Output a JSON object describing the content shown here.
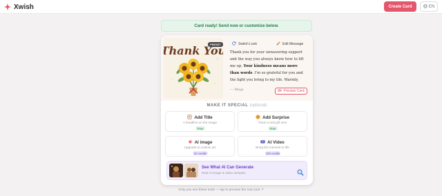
{
  "app": {
    "name": "Xwish"
  },
  "header": {
    "create_label": "Create Card",
    "language": "EN"
  },
  "banner": {
    "text": "Card ready! Send now or customize below."
  },
  "card": {
    "preset_badge": "PRESET",
    "art_text": "Thank You",
    "switch_label": "Switch Look",
    "edit_label": "Edit Message",
    "message_part1": "Thank you for your unwavering support and the way you always know how to lift me up. ",
    "message_bold": "Your kindness means more than words",
    "message_part2": ". I'm so grateful for you and the light you bring to my life. Warmly,",
    "signature": "— Maya",
    "preview_label": "Preview Card"
  },
  "special": {
    "title": "MAKE IT SPECIAL",
    "optional": "(optional)",
    "tiles": [
      {
        "title": "Add Title",
        "sub": "A headline on the image",
        "badge": "Free",
        "icon": "title-icon"
      },
      {
        "title": "Add Surprise",
        "sub": "Track a real gift sent",
        "badge": "Free",
        "icon": "gift-icon"
      },
      {
        "title": "AI image",
        "sub": "Upgrade to custom art",
        "badge": "20 credits",
        "icon": "ai-image-icon"
      },
      {
        "title": "AI Video",
        "sub": "Bring the moment to life",
        "badge": "100 credits",
        "icon": "ai-video-icon"
      }
    ]
  },
  "generate": {
    "title": "See What AI Can Generate",
    "sub": "Real AI image & video samples"
  },
  "footer": {
    "text": "Only you see these tools — tap to preview the real card ↗"
  },
  "colors": {
    "accent": "#e3566b",
    "success": "#2b7a4b",
    "purple": "#6b3fd0"
  }
}
